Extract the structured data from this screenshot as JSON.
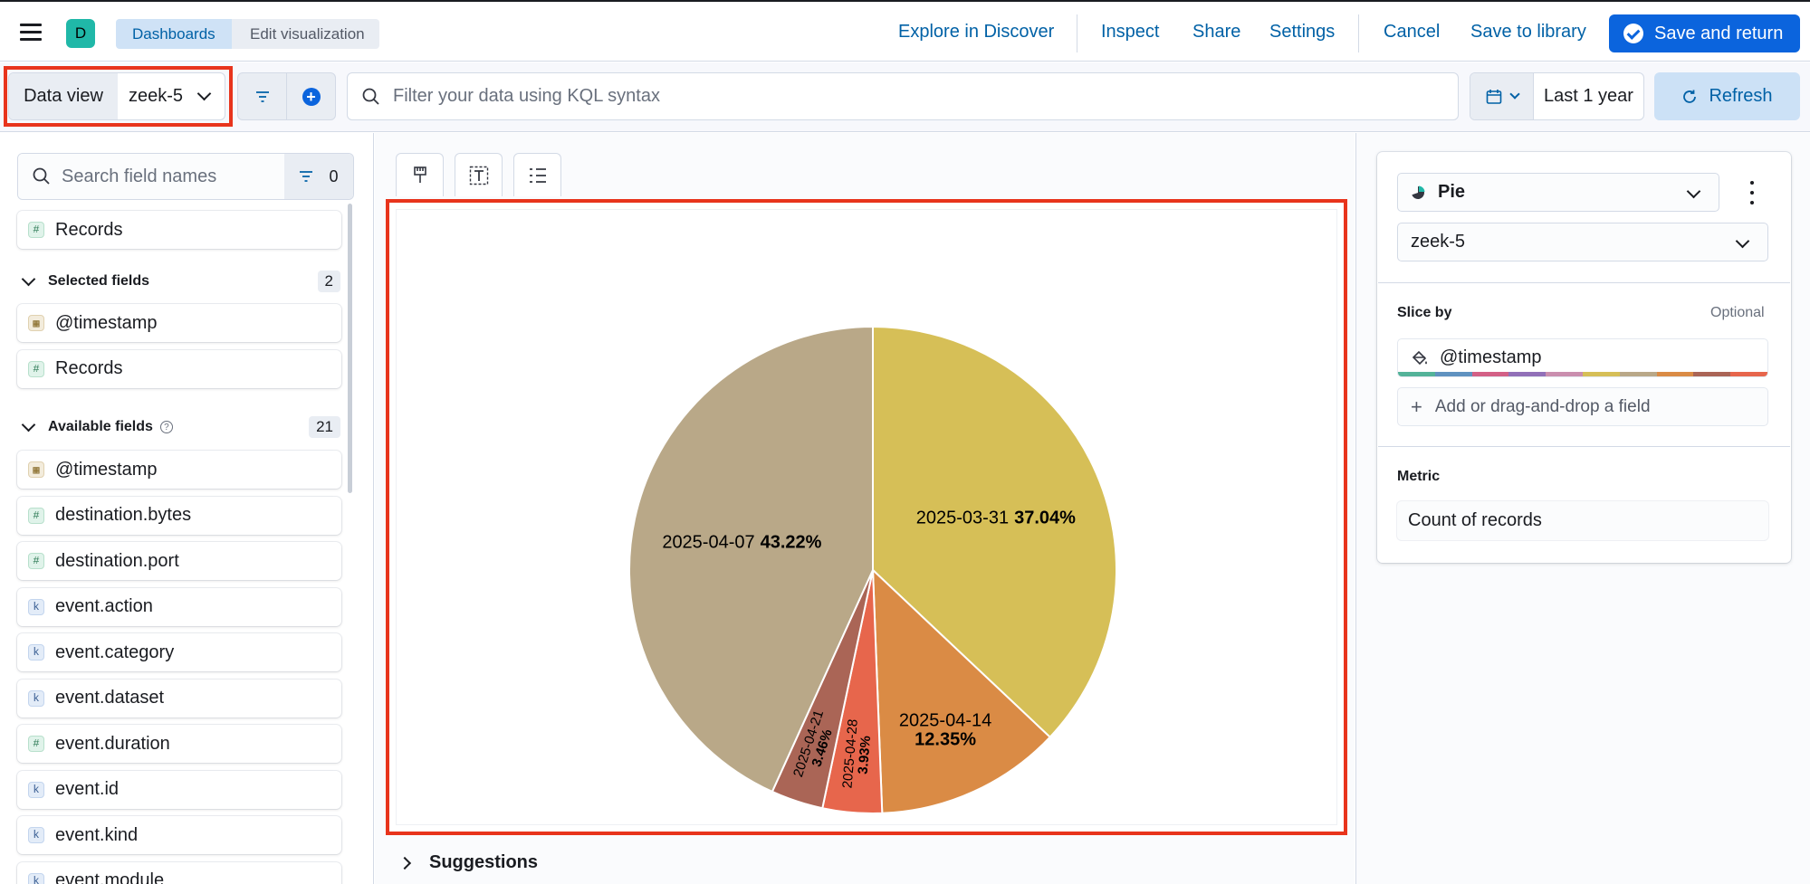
{
  "header": {
    "space_initial": "D",
    "breadcrumbs": [
      "Dashboards",
      "Edit visualization"
    ],
    "links": {
      "explore": "Explore in Discover",
      "inspect": "Inspect",
      "share": "Share",
      "settings": "Settings",
      "cancel": "Cancel",
      "save_library": "Save to library"
    },
    "save_return": "Save and return"
  },
  "query": {
    "data_view_label": "Data view",
    "data_view_value": "zeek-5",
    "kql_placeholder": "Filter your data using KQL syntax",
    "date_range": "Last 1 year",
    "refresh": "Refresh"
  },
  "fields": {
    "search_placeholder": "Search field names",
    "filter_count": "0",
    "records": "Records",
    "selected_label": "Selected fields",
    "selected_count": "2",
    "selected": [
      {
        "name": "@timestamp",
        "type": "date"
      },
      {
        "name": "Records",
        "type": "number"
      }
    ],
    "available_label": "Available fields",
    "available_count": "21",
    "available": [
      {
        "name": "@timestamp",
        "type": "date"
      },
      {
        "name": "destination.bytes",
        "type": "number"
      },
      {
        "name": "destination.port",
        "type": "number"
      },
      {
        "name": "event.action",
        "type": "keyword"
      },
      {
        "name": "event.category",
        "type": "keyword"
      },
      {
        "name": "event.dataset",
        "type": "keyword"
      },
      {
        "name": "event.duration",
        "type": "number"
      },
      {
        "name": "event.id",
        "type": "keyword"
      },
      {
        "name": "event.kind",
        "type": "keyword"
      },
      {
        "name": "event.module",
        "type": "keyword"
      }
    ],
    "type_glyphs": {
      "number": "#",
      "keyword": "k",
      "date": "▦"
    }
  },
  "workspace": {
    "suggestions": "Suggestions"
  },
  "chart_data": {
    "type": "pie",
    "slices": [
      {
        "label": "2025-03-31",
        "pct": "37.04%",
        "value": 37.04,
        "color": "#d6bf57"
      },
      {
        "label": "2025-04-14",
        "pct": "12.35%",
        "value": 12.35,
        "color": "#da8b45"
      },
      {
        "label": "2025-04-28",
        "pct": "3.93%",
        "value": 3.93,
        "color": "#e7664c"
      },
      {
        "label": "2025-04-21",
        "pct": "3.46%",
        "value": 3.46,
        "color": "#aa6556"
      },
      {
        "label": "2025-04-07",
        "pct": "43.22%",
        "value": 43.22,
        "color": "#b9a888"
      }
    ]
  },
  "config": {
    "chart_type": "Pie",
    "data_view": "zeek-5",
    "slice_by_label": "Slice by",
    "optional": "Optional",
    "slice_field": "@timestamp",
    "add_field": "Add or drag-and-drop a field",
    "metric_label": "Metric",
    "metric_value": "Count of records",
    "palette": [
      "#54b399",
      "#6092c0",
      "#d36086",
      "#9170b8",
      "#ca8eae",
      "#d6bf57",
      "#b9a888",
      "#da8b45",
      "#aa6556",
      "#e7664c"
    ]
  }
}
